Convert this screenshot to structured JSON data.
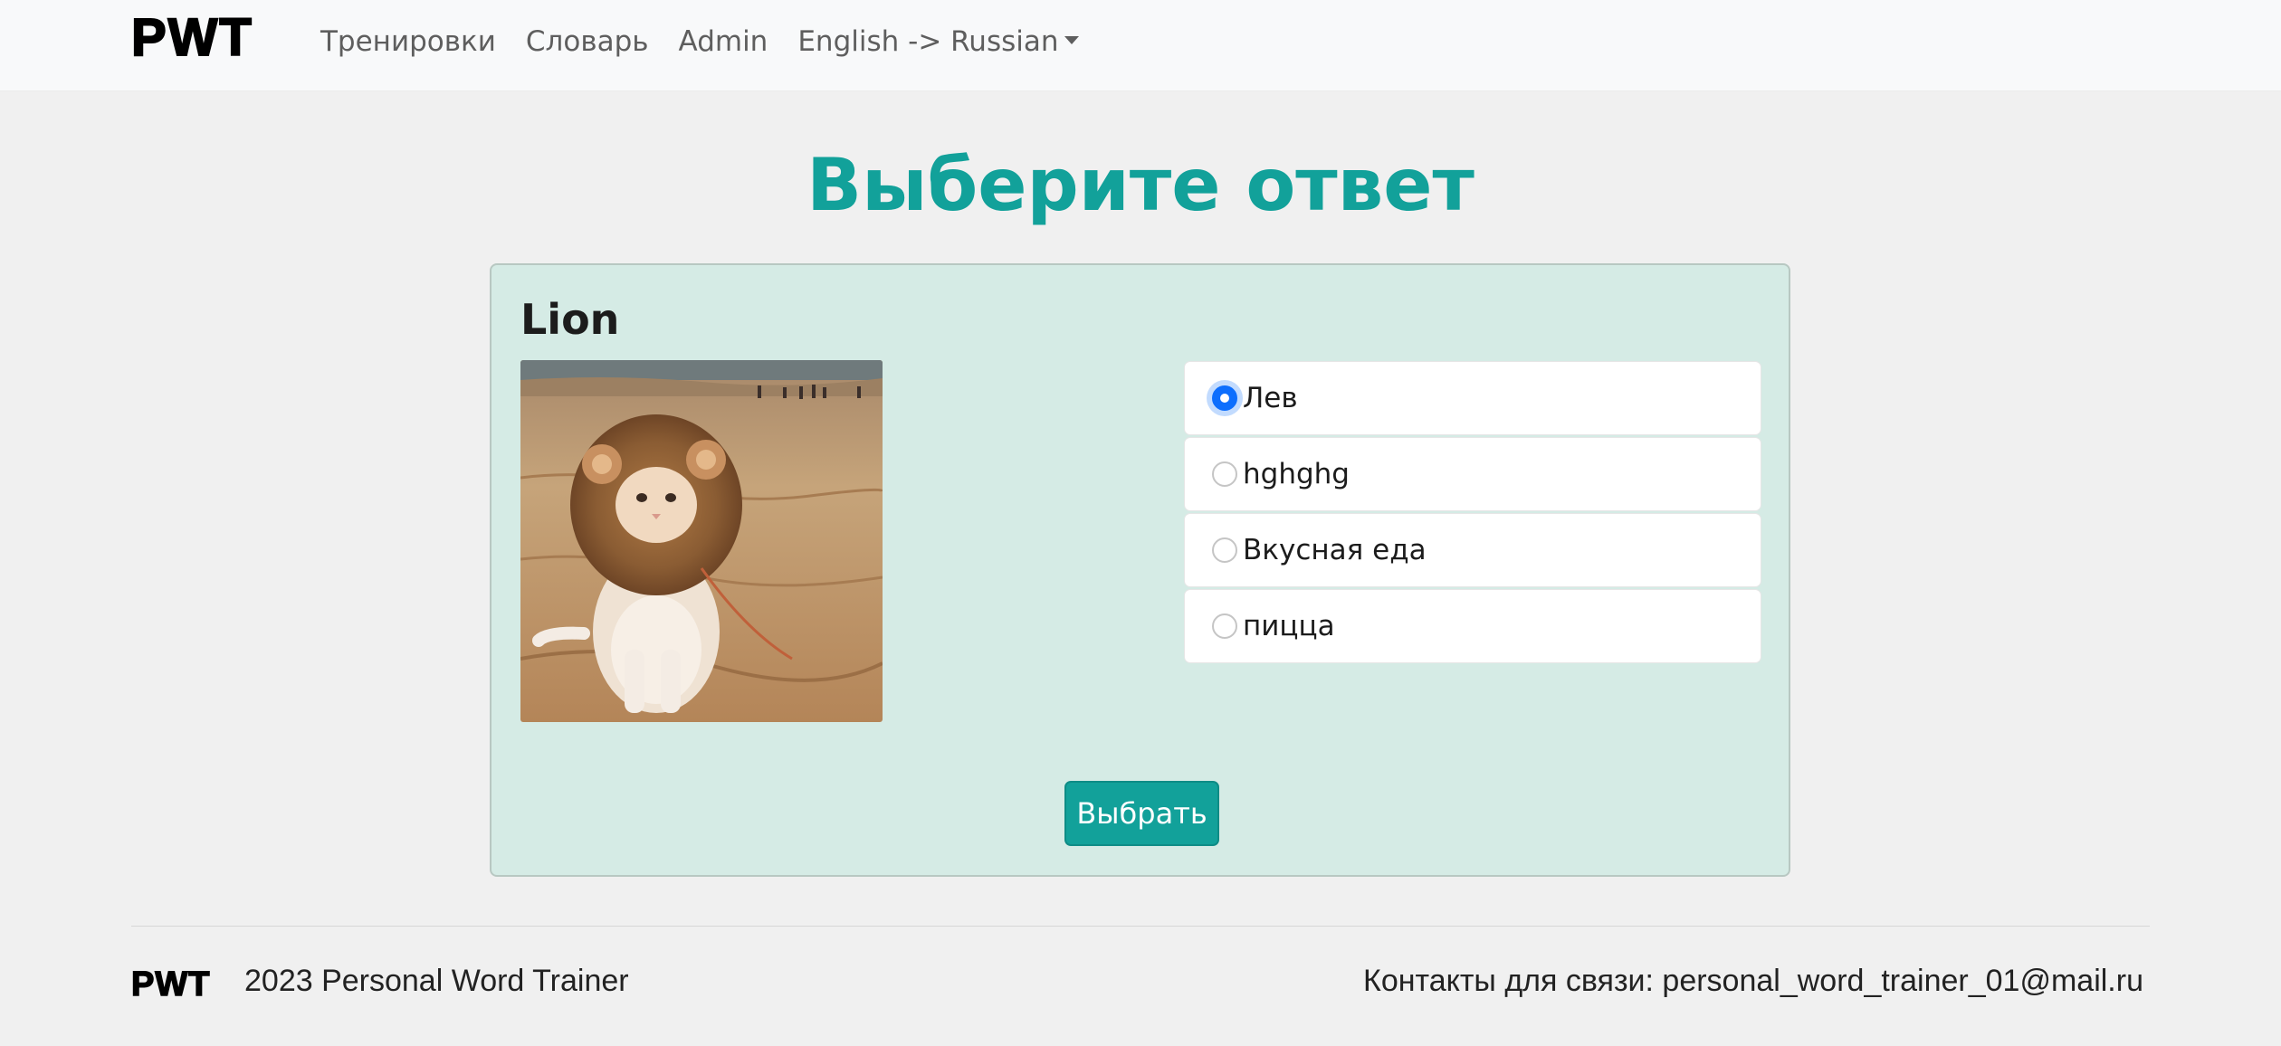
{
  "navbar": {
    "brand": "PWT",
    "links": [
      {
        "label": "Тренировки"
      },
      {
        "label": "Словарь"
      },
      {
        "label": "Admin"
      },
      {
        "label": "English -> Russian"
      }
    ]
  },
  "page": {
    "title": "Выберите ответ"
  },
  "quiz": {
    "word": "Lion",
    "image_alt": "cat wearing lion mane costume on sand",
    "options": [
      {
        "label": "Лев",
        "selected": true
      },
      {
        "label": "hghghg",
        "selected": false
      },
      {
        "label": "Вкусная еда",
        "selected": false
      },
      {
        "label": "пицца",
        "selected": false
      }
    ],
    "submit_label": "Выбрать"
  },
  "footer": {
    "brand": "PWT",
    "copyright": "2023 Personal Word Trainer",
    "contact": "Контакты для связи: personal_word_trainer_01@mail.ru"
  },
  "colors": {
    "accent": "#12a19a",
    "card_bg": "#d5ebe5",
    "radio_checked": "#0d6efd",
    "page_bg": "#f0f0f0"
  }
}
